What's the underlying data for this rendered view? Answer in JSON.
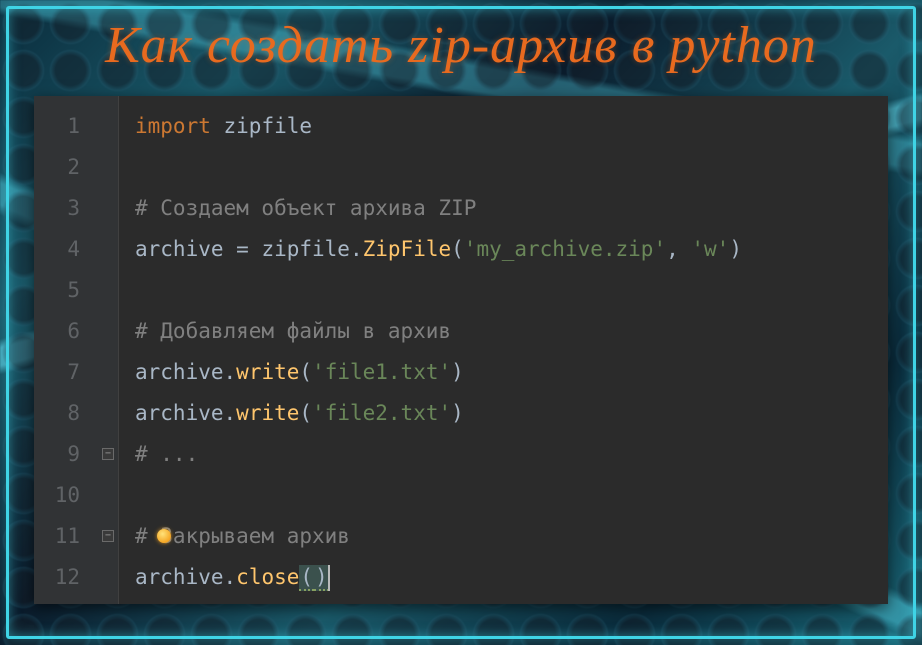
{
  "title": "Как создать zip-архив в python",
  "editor": {
    "line_numbers": [
      "1",
      "2",
      "3",
      "4",
      "5",
      "6",
      "7",
      "8",
      "9",
      "10",
      "11",
      "12"
    ],
    "fold_markers": [
      {
        "line": 9,
        "glyph": "−"
      },
      {
        "line": 11,
        "glyph": "−"
      }
    ],
    "bulb_line": 11,
    "lines": [
      {
        "tokens": [
          {
            "t": "import ",
            "c": "kw"
          },
          {
            "t": "zipfile",
            "c": "id"
          }
        ]
      },
      {
        "tokens": []
      },
      {
        "tokens": [
          {
            "t": "# Создаем объект архива ZIP",
            "c": "cmt"
          }
        ]
      },
      {
        "tokens": [
          {
            "t": "archive ",
            "c": "id"
          },
          {
            "t": "= ",
            "c": "op"
          },
          {
            "t": "zipfile",
            "c": "id"
          },
          {
            "t": ".",
            "c": "op"
          },
          {
            "t": "ZipFile",
            "c": "fn"
          },
          {
            "t": "(",
            "c": "op"
          },
          {
            "t": "'my_archive.zip'",
            "c": "str"
          },
          {
            "t": ", ",
            "c": "op"
          },
          {
            "t": "'w'",
            "c": "str"
          },
          {
            "t": ")",
            "c": "op"
          }
        ]
      },
      {
        "tokens": []
      },
      {
        "tokens": [
          {
            "t": "# Добавляем файлы в архив",
            "c": "cmt"
          }
        ]
      },
      {
        "tokens": [
          {
            "t": "archive",
            "c": "id"
          },
          {
            "t": ".",
            "c": "op"
          },
          {
            "t": "write",
            "c": "fn"
          },
          {
            "t": "(",
            "c": "op"
          },
          {
            "t": "'file1.txt'",
            "c": "str"
          },
          {
            "t": ")",
            "c": "op"
          }
        ]
      },
      {
        "tokens": [
          {
            "t": "archive",
            "c": "id"
          },
          {
            "t": ".",
            "c": "op"
          },
          {
            "t": "write",
            "c": "fn"
          },
          {
            "t": "(",
            "c": "op"
          },
          {
            "t": "'file2.txt'",
            "c": "str"
          },
          {
            "t": ")",
            "c": "op"
          }
        ]
      },
      {
        "tokens": [
          {
            "t": "# ...",
            "c": "cmt"
          }
        ]
      },
      {
        "tokens": []
      },
      {
        "tokens": [
          {
            "t": "# Закрываем архив",
            "c": "cmt"
          }
        ]
      },
      {
        "tokens": [
          {
            "t": "archive",
            "c": "id"
          },
          {
            "t": ".",
            "c": "op"
          },
          {
            "t": "close",
            "c": "fn"
          },
          {
            "t": "(",
            "c": "par-hl"
          },
          {
            "t": ")",
            "c": "par-hl"
          }
        ],
        "caret": true
      }
    ]
  }
}
